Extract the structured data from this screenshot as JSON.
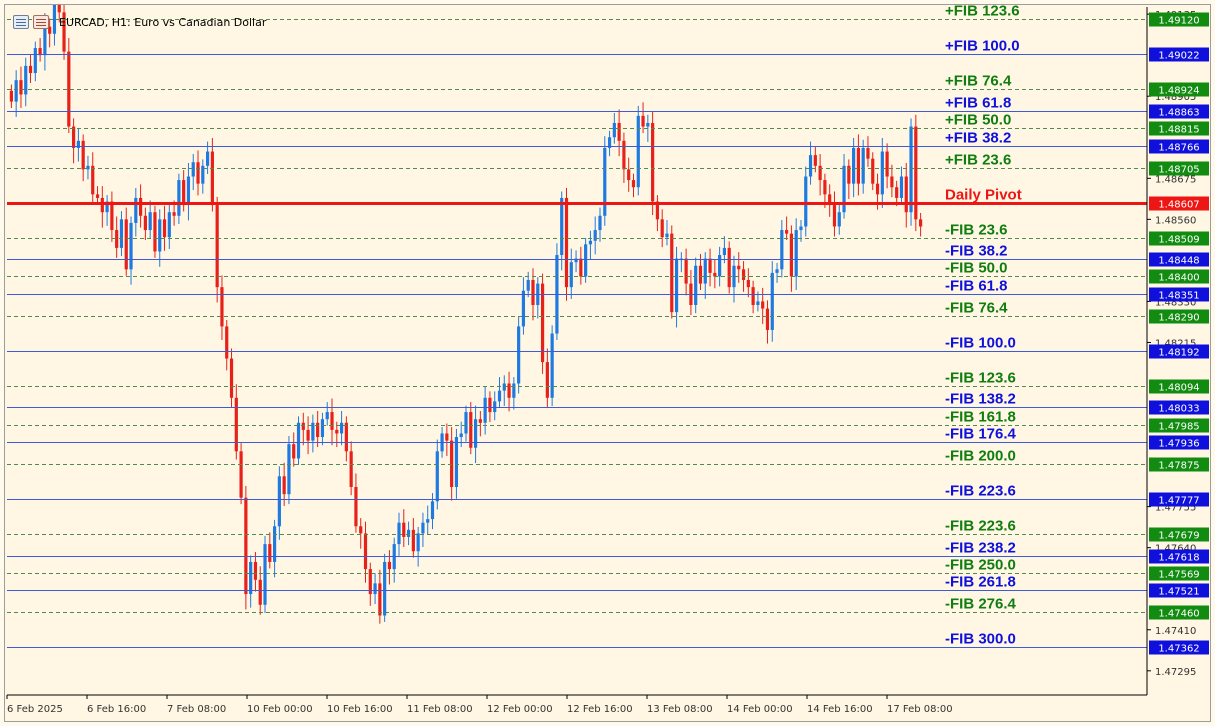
{
  "header": {
    "title": "EURCAD, H1:  Euro vs Canadian Dollar",
    "icons": [
      "trade-panel-icon",
      "chart-icon"
    ]
  },
  "colors": {
    "background": "#fff7e3",
    "bull": "#1e7ae0",
    "bear": "#e8201a",
    "pivot": "#ee1515",
    "fib_plus_green": "#0f7d0f",
    "fib_blue": "#1010dd",
    "line_blue": "#3e5bd7",
    "line_green": "#4f8a4f",
    "axis_text": "#333333"
  },
  "chart_data": {
    "type": "candlestick",
    "symbol": "EURCAD",
    "timeframe": "H1",
    "ylim": [
      1.4723,
      1.49155
    ],
    "x_ticks": [
      "6 Feb 2025",
      "6 Feb 16:00",
      "7 Feb 08:00",
      "10 Feb 00:00",
      "10 Feb 16:00",
      "11 Feb 08:00",
      "12 Feb 00:00",
      "12 Feb 16:00",
      "13 Feb 08:00",
      "14 Feb 00:00",
      "14 Feb 16:00",
      "17 Feb 08:00"
    ],
    "y_ticks": [
      "1.49135",
      "1.48905",
      "1.48675",
      "1.48560",
      "1.48330",
      "1.48215",
      "1.47755",
      "1.47640",
      "1.47410",
      "1.47295"
    ],
    "levels": [
      {
        "label": "+FIB 123.6",
        "price": "1.49120",
        "kind": "green"
      },
      {
        "label": "+FIB 100.0",
        "price": "1.49022",
        "kind": "blue"
      },
      {
        "label": "+FIB 76.4",
        "price": "1.48924",
        "kind": "green"
      },
      {
        "label": "+FIB 61.8",
        "price": "1.48863",
        "kind": "blue"
      },
      {
        "label": "+FIB 50.0",
        "price": "1.48815",
        "kind": "green"
      },
      {
        "label": "+FIB 38.2",
        "price": "1.48766",
        "kind": "blue"
      },
      {
        "label": "+FIB 23.6",
        "price": "1.48705",
        "kind": "green"
      },
      {
        "label": "Daily Pivot",
        "price": "1.48607",
        "kind": "pivot"
      },
      {
        "label": "-FIB 23.6",
        "price": "1.48509",
        "kind": "green"
      },
      {
        "label": "-FIB 38.2",
        "price": "1.48448",
        "kind": "blue"
      },
      {
        "label": "-FIB 50.0",
        "price": "1.48400",
        "kind": "green"
      },
      {
        "label": "-FIB 61.8",
        "price": "1.48351",
        "kind": "blue"
      },
      {
        "label": "-FIB 76.4",
        "price": "1.48290",
        "kind": "green"
      },
      {
        "label": "-FIB 100.0",
        "price": "1.48192",
        "kind": "blue"
      },
      {
        "label": "-FIB 123.6",
        "price": "1.48094",
        "kind": "green"
      },
      {
        "label": "-FIB 138.2",
        "price": "1.48033",
        "kind": "blue"
      },
      {
        "label": "-FIB 161.8",
        "price": "1.47985",
        "kind": "green"
      },
      {
        "label": "-FIB 176.4",
        "price": "1.47936",
        "kind": "blue"
      },
      {
        "label": "-FIB 200.0",
        "price": "1.47875",
        "kind": "green"
      },
      {
        "label": "-FIB 223.6",
        "price": "1.47777",
        "kind": "blue"
      },
      {
        "label": "-FIB 223.6",
        "price": "1.47679",
        "kind": "green"
      },
      {
        "label": "-FIB 238.2",
        "price": "1.47618",
        "kind": "blue"
      },
      {
        "label": "-FIB 250.0",
        "price": "1.47569",
        "kind": "green"
      },
      {
        "label": "-FIB 261.8",
        "price": "1.47521",
        "kind": "blue"
      },
      {
        "label": "-FIB 276.4",
        "price": "1.47460",
        "kind": "green"
      },
      {
        "label": "-FIB 300.0",
        "price": "1.47362",
        "kind": "blue"
      }
    ],
    "price_path": [
      1.4889,
      1.4895,
      1.4891,
      1.4899,
      1.4897,
      1.4904,
      1.4902,
      1.491,
      1.4908,
      1.4918,
      1.4914,
      1.4903,
      1.4882,
      1.4876,
      1.4878,
      1.487,
      1.4871,
      1.4863,
      1.4862,
      1.4858,
      1.4861,
      1.4853,
      1.4848,
      1.4856,
      1.4842,
      1.4855,
      1.4862,
      1.4857,
      1.4853,
      1.4858,
      1.4847,
      1.4856,
      1.4851,
      1.4858,
      1.4857,
      1.4867,
      1.486,
      1.4868,
      1.4872,
      1.4866,
      1.4871,
      1.4875,
      1.486,
      1.4837,
      1.4826,
      1.4817,
      1.4806,
      1.4791,
      1.4778,
      1.4751,
      1.476,
      1.4755,
      1.4748,
      1.4765,
      1.476,
      1.477,
      1.4784,
      1.4779,
      1.4793,
      1.4789,
      1.4799,
      1.4797,
      1.4794,
      1.4799,
      1.4795,
      1.48,
      1.4802,
      1.4797,
      1.4796,
      1.4799,
      1.4791,
      1.4781,
      1.477,
      1.4768,
      1.4758,
      1.4751,
      1.4754,
      1.4745,
      1.476,
      1.4758,
      1.4765,
      1.4771,
      1.4767,
      1.4769,
      1.4763,
      1.4768,
      1.4771,
      1.4772,
      1.4777,
      1.4791,
      1.4796,
      1.4794,
      1.4781,
      1.4795,
      1.4796,
      1.4802,
      1.4792,
      1.48,
      1.4799,
      1.4806,
      1.4802,
      1.4805,
      1.4808,
      1.481,
      1.4806,
      1.481,
      1.4826,
      1.4836,
      1.4839,
      1.4832,
      1.4838,
      1.4816,
      1.4806,
      1.4824,
      1.4846,
      1.4862,
      1.4837,
      1.4844,
      1.4845,
      1.484,
      1.4849,
      1.485,
      1.4853,
      1.4857,
      1.4876,
      1.4879,
      1.4883,
      1.4878,
      1.487,
      1.4867,
      1.4865,
      1.4885,
      1.4882,
      1.4883,
      1.4861,
      1.4856,
      1.4851,
      1.4852,
      1.483,
      1.4845,
      1.4845,
      1.4838,
      1.4832,
      1.4843,
      1.4838,
      1.4845,
      1.4841,
      1.484,
      1.4846,
      1.4848,
      1.4837,
      1.4843,
      1.4842,
      1.4839,
      1.4837,
      1.4832,
      1.4833,
      1.4831,
      1.4825,
      1.4841,
      1.4842,
      1.4853,
      1.4852,
      1.484,
      1.4853,
      1.4854,
      1.4868,
      1.4874,
      1.4871,
      1.4867,
      1.4863,
      1.486,
      1.4854,
      1.4858,
      1.4871,
      1.4866,
      1.4876,
      1.4866,
      1.4876,
      1.4873,
      1.4866,
      1.4863,
      1.4875,
      1.4868,
      1.4865,
      1.4862,
      1.4868,
      1.4858,
      1.4882,
      1.4856,
      1.4854
    ]
  }
}
